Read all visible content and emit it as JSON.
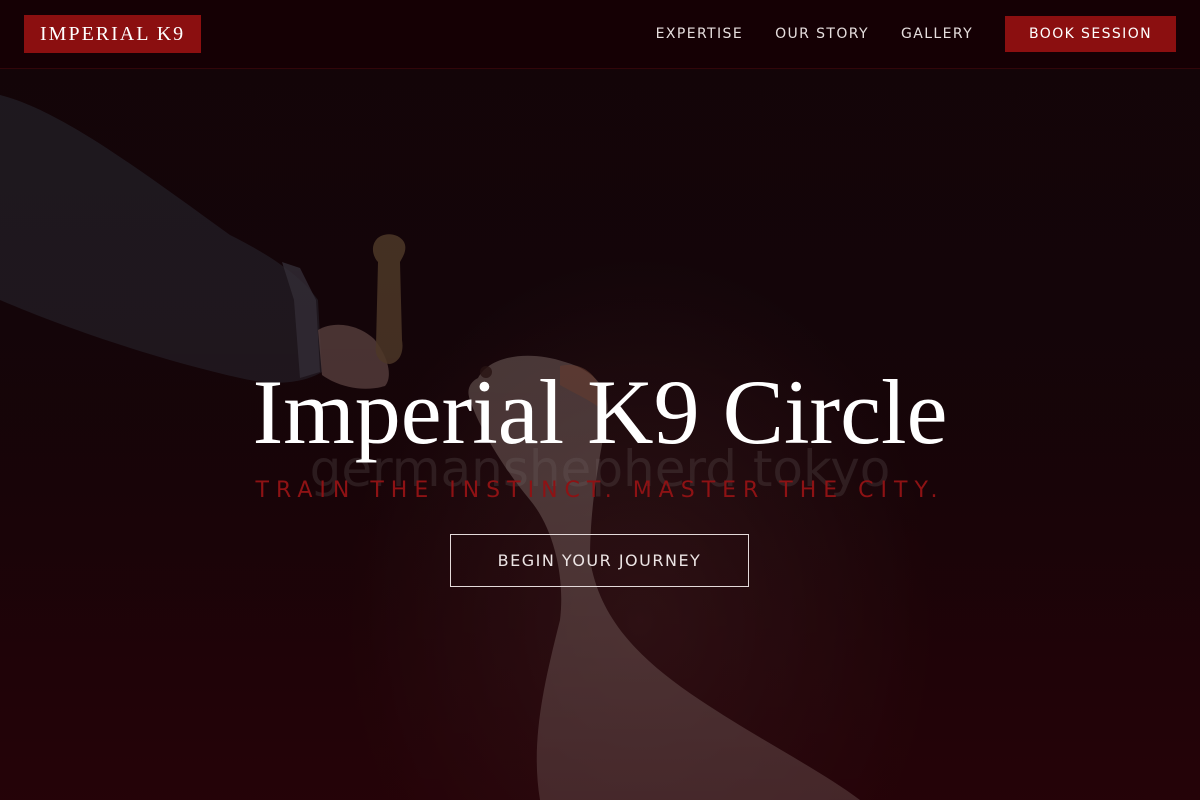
{
  "header": {
    "logo": "IMPERIAL K9",
    "nav": [
      {
        "label": "EXPERTISE"
      },
      {
        "label": "OUR STORY"
      },
      {
        "label": "GALLERY"
      }
    ],
    "book_label": "BOOK SESSION"
  },
  "hero": {
    "title": "Imperial K9 Circle",
    "subtitle": "TRAIN THE INSTINCT. MASTER THE CITY.",
    "cta_label": "BEGIN YOUR JOURNEY",
    "watermark": "germanshepherd tokyo"
  },
  "colors": {
    "brand": "#8b0f10",
    "background": "#110004",
    "subtitle": "#8e1214"
  }
}
